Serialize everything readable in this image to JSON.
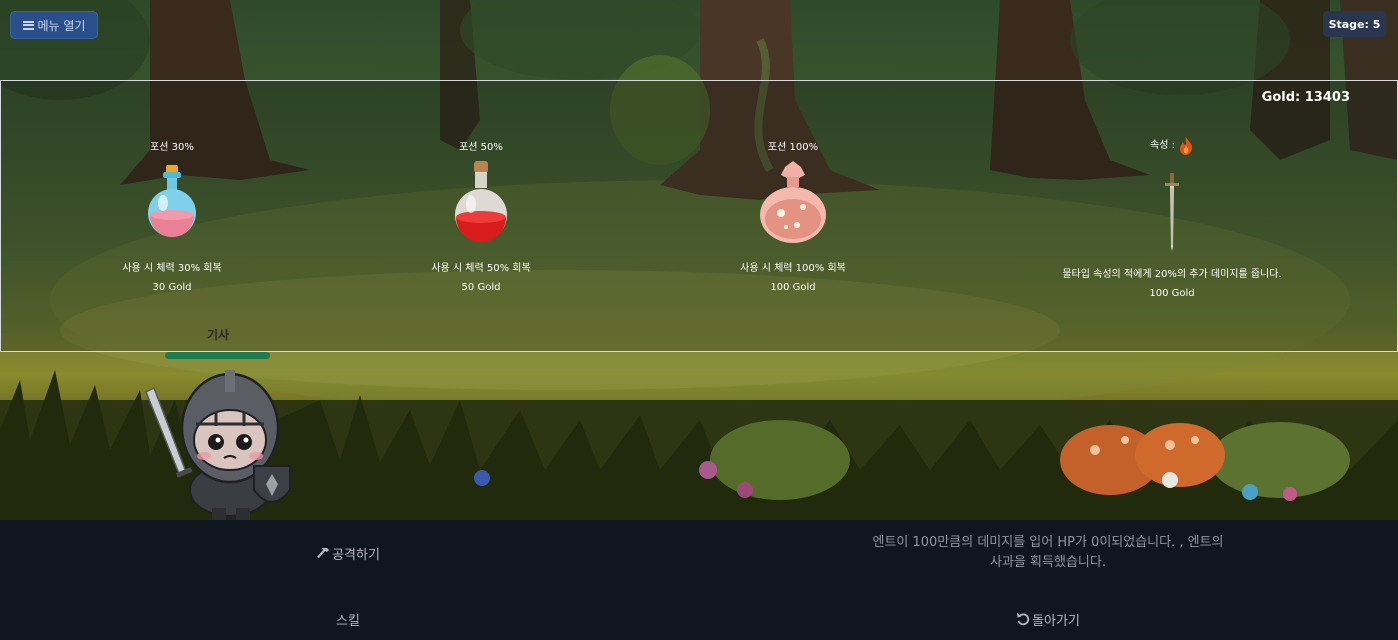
{
  "menu": {
    "label": "메뉴 열기",
    "icon": "menu-icon"
  },
  "stage": {
    "label": "Stage: 5"
  },
  "shop": {
    "gold_label": "Gold: 13403",
    "items": [
      {
        "name": "포션 30%",
        "description": "사용 시 체력 30% 회복",
        "price": "30 Gold",
        "icon": "potion-blue-icon"
      },
      {
        "name": "포션 50%",
        "description": "사용 시 체력 50% 회복",
        "price": "50 Gold",
        "icon": "potion-red-icon"
      },
      {
        "name": "포션 100%",
        "description": "사용 시 체력 100% 회복",
        "price": "100 Gold",
        "icon": "potion-pink-icon"
      },
      {
        "name": "속성 :",
        "description": "물타입 속성의 적에게 20%의 추가 데미지를 줍니다.",
        "price": "100 Gold",
        "icon": "sword-icon",
        "element_icon": "fire-icon"
      }
    ]
  },
  "character": {
    "name": "기사",
    "hp_fraction": 1.0,
    "hp_color": "#1f7a4d"
  },
  "actions": {
    "attack_label": "공격하기",
    "skill_label": "스킬",
    "back_label": "돌아가기"
  },
  "log": {
    "message": "엔트이 100만큼의 데미지를 입어 HP가 0이되었습니다. , 엔트의 사과을 획득했습니다."
  }
}
